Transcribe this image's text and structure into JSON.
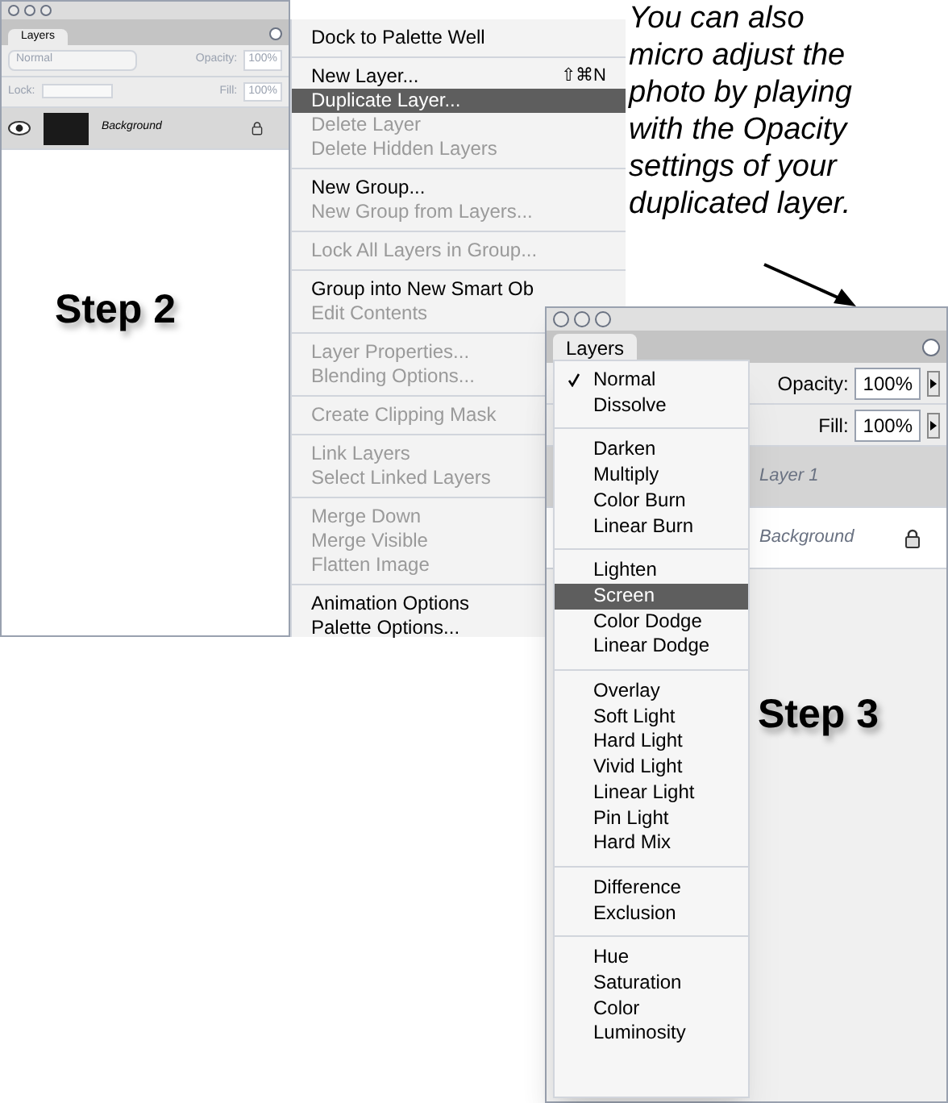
{
  "left_panel": {
    "tab": "Layers",
    "blend_mode": "Normal",
    "opacity_label": "Opacity:",
    "opacity": "100%",
    "lock_label": "Lock:",
    "fill_label": "Fill:",
    "fill": "100%",
    "fields_disabled": true,
    "layers": [
      {
        "name": "Background",
        "visible": true,
        "locked": true
      }
    ]
  },
  "step_2": "Step 2",
  "layers_menu": {
    "groups": [
      {
        "items": [
          {
            "label": "Dock to Palette Well",
            "disabled": false,
            "selected": false
          }
        ]
      },
      {
        "items": [
          {
            "label": "New Layer...",
            "shortcut": "⇧⌘N",
            "disabled": false,
            "selected": false
          },
          {
            "label": "Duplicate Layer...",
            "disabled": false,
            "selected": true
          },
          {
            "label": "Delete Layer",
            "disabled": true,
            "selected": false
          },
          {
            "label": "Delete Hidden Layers",
            "disabled": true,
            "selected": false
          }
        ]
      },
      {
        "items": [
          {
            "label": "New Group...",
            "disabled": false,
            "selected": false
          },
          {
            "label": "New Group from Layers...",
            "disabled": true,
            "selected": false
          }
        ]
      },
      {
        "items": [
          {
            "label": "Lock All Layers in Group...",
            "disabled": true,
            "selected": false
          }
        ]
      },
      {
        "items": [
          {
            "label": "Group into New Smart Ob",
            "disabled": false,
            "selected": false
          },
          {
            "label": "Edit Contents",
            "disabled": true,
            "selected": false
          }
        ]
      },
      {
        "items": [
          {
            "label": "Layer Properties...",
            "disabled": true,
            "selected": false
          },
          {
            "label": "Blending Options...",
            "disabled": true,
            "selected": false
          }
        ]
      },
      {
        "items": [
          {
            "label": "Create Clipping Mask",
            "disabled": true,
            "selected": false
          }
        ]
      },
      {
        "items": [
          {
            "label": "Link Layers",
            "disabled": true,
            "selected": false
          },
          {
            "label": "Select Linked Layers",
            "disabled": true,
            "selected": false
          }
        ]
      },
      {
        "items": [
          {
            "label": "Merge Down",
            "disabled": true,
            "selected": false
          },
          {
            "label": "Merge Visible",
            "disabled": true,
            "selected": false
          },
          {
            "label": "Flatten Image",
            "disabled": true,
            "selected": false
          }
        ]
      },
      {
        "items": [
          {
            "label": "Animation Options",
            "disabled": false,
            "selected": false
          },
          {
            "label": "Palette Options...",
            "disabled": false,
            "selected": false
          }
        ]
      }
    ]
  },
  "caption_lines": [
    "You can also",
    "micro adjust the",
    "photo by playing",
    "with the Opacity",
    "settings of your",
    "duplicated layer."
  ],
  "right_panel": {
    "tab": "Layers",
    "opacity_label": "Opacity:",
    "opacity": "100%",
    "fill_label": "Fill:",
    "fill": "100%",
    "layers": [
      {
        "name": "Layer 1",
        "selected": true,
        "locked": false
      },
      {
        "name": "Background",
        "selected": false,
        "locked": true
      }
    ],
    "blend_menu": {
      "groups": [
        {
          "items": [
            {
              "label": "Normal",
              "checked": true,
              "selected": false
            },
            {
              "label": "Dissolve",
              "checked": false,
              "selected": false
            }
          ]
        },
        {
          "items": [
            {
              "label": "Darken",
              "checked": false,
              "selected": false
            },
            {
              "label": "Multiply",
              "checked": false,
              "selected": false
            },
            {
              "label": "Color Burn",
              "checked": false,
              "selected": false
            },
            {
              "label": "Linear Burn",
              "checked": false,
              "selected": false
            }
          ]
        },
        {
          "items": [
            {
              "label": "Lighten",
              "checked": false,
              "selected": false
            },
            {
              "label": "Screen",
              "checked": false,
              "selected": true
            },
            {
              "label": "Color Dodge",
              "checked": false,
              "selected": false
            },
            {
              "label": "Linear Dodge",
              "checked": false,
              "selected": false
            }
          ]
        },
        {
          "items": [
            {
              "label": "Overlay",
              "checked": false,
              "selected": false
            },
            {
              "label": "Soft Light",
              "checked": false,
              "selected": false
            },
            {
              "label": "Hard Light",
              "checked": false,
              "selected": false
            },
            {
              "label": "Vivid Light",
              "checked": false,
              "selected": false
            },
            {
              "label": "Linear Light",
              "checked": false,
              "selected": false
            },
            {
              "label": "Pin Light",
              "checked": false,
              "selected": false
            },
            {
              "label": "Hard Mix",
              "checked": false,
              "selected": false
            }
          ]
        },
        {
          "items": [
            {
              "label": "Difference",
              "checked": false,
              "selected": false
            },
            {
              "label": "Exclusion",
              "checked": false,
              "selected": false
            }
          ]
        },
        {
          "items": [
            {
              "label": "Hue",
              "checked": false,
              "selected": false
            },
            {
              "label": "Saturation",
              "checked": false,
              "selected": false
            },
            {
              "label": "Color",
              "checked": false,
              "selected": false
            },
            {
              "label": "Luminosity",
              "checked": false,
              "selected": false
            }
          ]
        }
      ]
    }
  },
  "step_3": "Step 3"
}
